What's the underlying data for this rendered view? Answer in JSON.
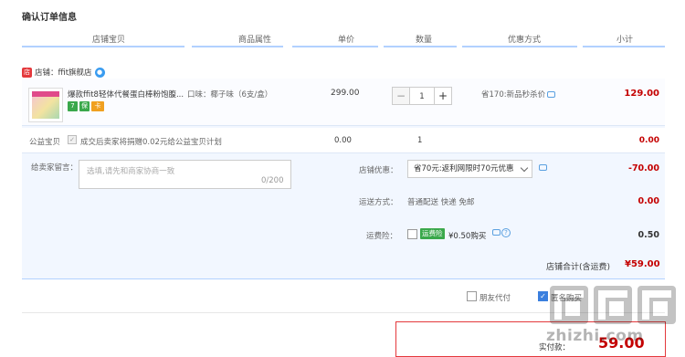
{
  "page": {
    "title": "确认订单信息"
  },
  "columns": [
    "店铺宝贝",
    "商品属性",
    "单价",
    "数量",
    "优惠方式",
    "小计"
  ],
  "shop": {
    "badge": "店",
    "label": "店铺：ffit旗舰店"
  },
  "item": {
    "title": "爆款ffit8轻体代餐蛋白棒粉饱腹...",
    "attribute": "口味：椰子味（6支/盒）",
    "price": "299.00",
    "quantity": "1",
    "discount": "省170:新品秒杀价",
    "subtotal": "129.00",
    "badges": [
      "7",
      "保",
      "卡"
    ]
  },
  "charity": {
    "label": "公益宝贝",
    "text": "成交后卖家将捐赠0.02元给公益宝贝计划",
    "price": "0.00",
    "quantity": "1",
    "subtotal": "0.00"
  },
  "message": {
    "label": "给卖家留言：",
    "placeholder": "选填,请先和商家协商一致",
    "count": "0/200"
  },
  "coupon": {
    "label": "店铺优惠：",
    "selected": "省70元:返利网限时70元优惠",
    "value": "-70.00"
  },
  "shipping": {
    "label": "运送方式：",
    "method": "普通配送 快递 免邮",
    "value": "0.00"
  },
  "insurance": {
    "label": "运费险：",
    "badge": "运费险",
    "price": "¥0.50购买",
    "help": "?",
    "value": "0.50"
  },
  "total": {
    "label": "店铺合计(含运费)",
    "value": "¥59.00"
  },
  "footer": {
    "friend_pay": "朋友代付",
    "anon": "匿名购买"
  },
  "pay": {
    "label": "实付款：",
    "amount": "59.00"
  },
  "watermark": {
    "text": "zhizhi.com"
  }
}
